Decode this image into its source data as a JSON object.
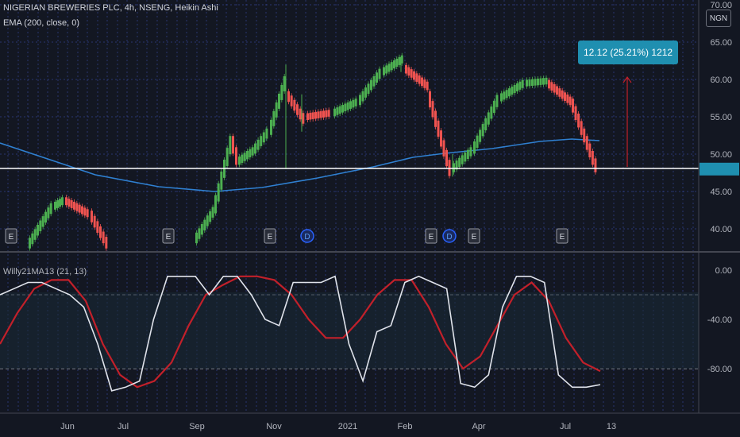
{
  "legend": {
    "symbol_line": "NIGERIAN BREWERIES PLC, 4h, NSENG, Heikin Ashi",
    "ema_line": "EMA (200, close, 0)",
    "oscillator_line": "Willy21MA13 (21, 13)"
  },
  "currency_badge": "NGN",
  "measure_label": "12.12 (25.21%) 1212",
  "colors": {
    "background": "#131722",
    "bull": "#4caf50",
    "bear": "#ef5350",
    "ema": "#2f80d1",
    "willy": "#e0e3eb",
    "willy_ma": "#c2202a",
    "grid": "#3b4fb0",
    "accent": "#1f8fb0",
    "measure_arrow": "#c2202a"
  },
  "event_markers": [
    "E",
    "E",
    "E",
    "D",
    "E",
    "D",
    "E",
    "E"
  ],
  "chart_data": [
    {
      "type": "candlestick",
      "title": "NIGERIAN BREWERIES PLC, 4h, NSENG, Heikin Ashi",
      "price_axis": [
        "70.00",
        "65.00",
        "60.00",
        "55.00",
        "50.00",
        "45.00",
        "40.00"
      ],
      "time_axis": [
        "Jun",
        "Jul",
        "Sep",
        "Nov",
        "2021",
        "Feb",
        "Apr",
        "Jul",
        "13"
      ],
      "ylim": [
        37.5,
        70
      ],
      "current_price": 48,
      "series": [
        {
          "name": "Heikin Ashi close (approx.)",
          "x": [
            "May",
            "Jun",
            "Jul",
            "Aug",
            "Sep",
            "Oct",
            "Nov",
            "Dec",
            "2021",
            "Feb",
            "Mar",
            "Apr",
            "May",
            "Jun",
            "Jul",
            "Jul end"
          ],
          "values": [
            38,
            43.5,
            38,
            40,
            45,
            50,
            59,
            56,
            59,
            62.5,
            57,
            48,
            52,
            58,
            59.5,
            48
          ]
        },
        {
          "name": "EMA (200, close, 0)",
          "x": [
            "May",
            "Jul",
            "Sep",
            "Nov",
            "2021",
            "Feb",
            "Apr",
            "Jul",
            "Jul end"
          ],
          "values": [
            51,
            47,
            45.2,
            46.3,
            48,
            50,
            51.3,
            52.2,
            51.8
          ]
        }
      ]
    },
    {
      "type": "line",
      "title": "Willy21MA13 (21, 13)",
      "y_axis": [
        "0.00",
        "-40.00",
        "-80.00"
      ],
      "ylim": [
        -100,
        5
      ],
      "bands": [
        -20,
        -80
      ],
      "series": [
        {
          "name": "Willy",
          "values": [
            -20,
            -15,
            -10,
            -10,
            -15,
            -20,
            -30,
            -60,
            -98,
            -95,
            -90,
            -40,
            -5,
            -5,
            -5,
            -20,
            -5,
            -5,
            -20,
            -40,
            -45,
            -10,
            -10,
            -10,
            -5,
            -60,
            -90,
            -50,
            -45,
            -10,
            -5,
            -10,
            -15,
            -92,
            -95,
            -85,
            -30,
            -5,
            -5,
            -10,
            -85,
            -95,
            -95,
            -93
          ]
        },
        {
          "name": "Willy MA",
          "values": [
            -60,
            -35,
            -15,
            -8,
            -8,
            -25,
            -60,
            -85,
            -95,
            -90,
            -75,
            -45,
            -20,
            -12,
            -5,
            -5,
            -8,
            -20,
            -40,
            -55,
            -55,
            -40,
            -20,
            -8,
            -8,
            -30,
            -60,
            -80,
            -70,
            -45,
            -20,
            -10,
            -25,
            -55,
            -75,
            -82
          ]
        }
      ]
    }
  ]
}
